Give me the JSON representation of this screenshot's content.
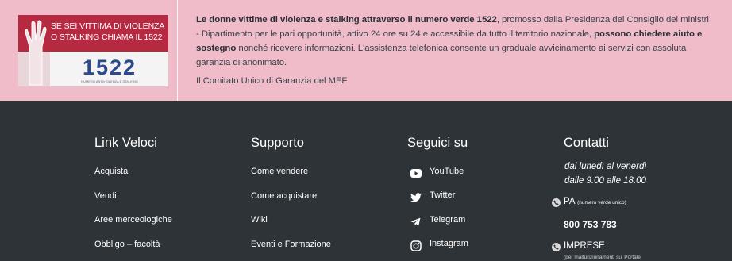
{
  "banner": {
    "image": {
      "slogan_line1": "SE SEI VITTIMA DI VIOLENZA",
      "slogan_line2": "O STALKING CHIAMA IL 1522",
      "number": "1522",
      "caption": "NUMERO ANTIVIOLENZA E STALKING",
      "brand_color": "#b52a40"
    },
    "text": {
      "p1": "Le donne vittime di violenza e stalking attraverso il numero verde 1522",
      "p2": ", promosso dalla Presidenza del Consiglio dei ministri - Dipartimento per le pari opportunità, attivo 24 ore su 24 e accessibile da tutto il territorio nazionale, ",
      "p3": "possono chiedere aiuto e sostegno",
      "p4": " nonché ricevere informazioni. L'assistenza telefonica consente un graduale avvicinamento ai servizi con assoluta garanzia di anonimato."
    },
    "link": "Il Comitato Unico di Garanzia del MEF",
    "background": "#f1bcc9"
  },
  "footer": {
    "background": "#2e3337",
    "link_veloci": {
      "title": "Link Veloci",
      "items": [
        "Acquista",
        "Vendi",
        "Aree merceologiche",
        "Obbligo – facoltà"
      ]
    },
    "supporto": {
      "title": "Supporto",
      "items": [
        "Come vendere",
        "Come acquistare",
        "Wiki",
        "Eventi e Formazione"
      ]
    },
    "seguici": {
      "title": "Seguici su",
      "items": [
        {
          "label": "YouTube",
          "icon": "youtube-icon"
        },
        {
          "label": "Twitter",
          "icon": "twitter-icon"
        },
        {
          "label": "Telegram",
          "icon": "telegram-icon"
        },
        {
          "label": "Instagram",
          "icon": "instagram-icon"
        }
      ]
    },
    "contatti": {
      "title": "Contatti",
      "hours_line1": "dal lunedì al venerdì",
      "hours_line2": "dalle 9.00 alle 18.00",
      "pa_label": "PA",
      "pa_sub": "(numero verde unico)",
      "phone": "800 753 783",
      "imprese_label": "IMPRESE",
      "imprese_note": "(per malfunzionamenti sul Portale"
    }
  }
}
